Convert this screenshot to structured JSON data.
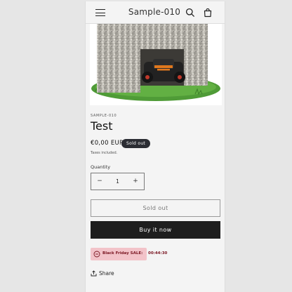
{
  "header": {
    "store_name": "Sample-010",
    "icons": [
      "hamburger-menu-icon",
      "search-icon",
      "cart-icon"
    ]
  },
  "product": {
    "vendor": "SAMPLE-010",
    "title": "Test",
    "price": "€0,00 EUR",
    "badge": "Sold out",
    "taxes_note": "Taxes included.",
    "quantity_label": "Quantity",
    "quantity_value": "1",
    "decrease_symbol": "−",
    "increase_symbol": "+",
    "sold_out_button": "Sold out",
    "buy_now_button": "Buy it now",
    "sale_label": "Black Friday SALE:",
    "sale_timer": "00:44:30",
    "share_label": "Share"
  },
  "colors": {
    "badge_bg": "#2b2d33",
    "buy_button_bg": "#1e1e1e",
    "sale_bg": "#f2c3c9",
    "sale_text": "#7a1622"
  }
}
